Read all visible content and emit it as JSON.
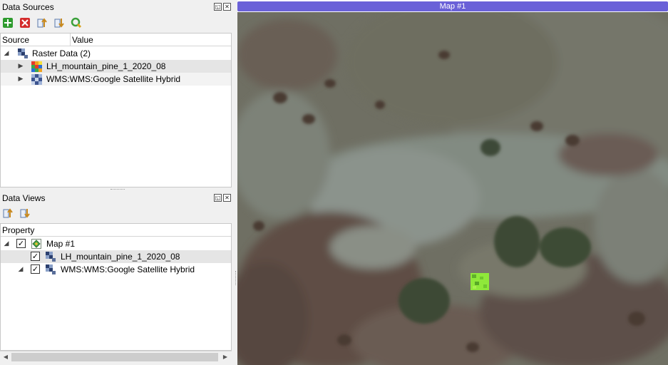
{
  "data_sources": {
    "title": "Data Sources",
    "toolbar_icons": [
      "add-icon",
      "remove-icon",
      "move-up-icon",
      "move-down-icon",
      "refresh-icon"
    ],
    "columns": [
      "Source",
      "Value"
    ],
    "group": {
      "label": "Raster Data (2)"
    },
    "items": [
      {
        "label": "LH_mountain_pine_1_2020_08"
      },
      {
        "label": "WMS:WMS:Google Satellite Hybrid"
      }
    ]
  },
  "data_views": {
    "title": "Data Views",
    "toolbar_icons": [
      "move-up-icon",
      "move-down-icon"
    ],
    "column": "Property",
    "map": {
      "label": "Map #1",
      "checked": true
    },
    "layers": [
      {
        "label": "LH_mountain_pine_1_2020_08",
        "checked": true
      },
      {
        "label": "WMS:WMS:Google Satellite Hybrid",
        "checked": true
      }
    ]
  },
  "map": {
    "title": "Map #1",
    "title_bar_color": "#6a61d8"
  },
  "title_buttons": {
    "float": "◱",
    "close": "✕"
  },
  "glyphs": {
    "expanded": "◢",
    "collapsed": "▶",
    "check": "✓",
    "scroll_left": "◀",
    "scroll_right": "▶"
  }
}
